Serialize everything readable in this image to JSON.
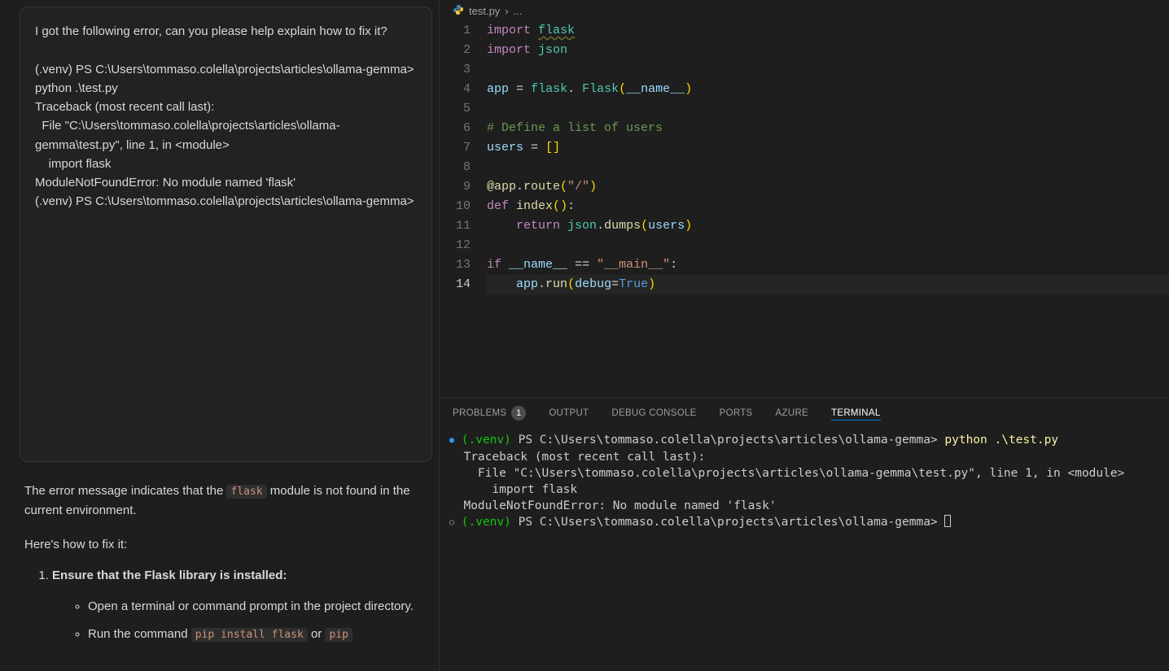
{
  "chat": {
    "user_message": "I got the following error, can you please help explain how to fix it?\n\n(.venv) PS C:\\Users\\tommaso.colella\\projects\\articles\\ollama-gemma> python .\\test.py\nTraceback (most recent call last):\n  File \"C:\\Users\\tommaso.colella\\projects\\articles\\ollama-gemma\\test.py\", line 1, in <module>\n    import flask\nModuleNotFoundError: No module named 'flask'\n(.venv) PS C:\\Users\\tommaso.colella\\projects\\articles\\ollama-gemma>",
    "response_intro_pre": "The error message indicates that the ",
    "response_intro_code": "flask",
    "response_intro_post": " module is not found in the current environment.",
    "response_heres_how": "Here's how to fix it:",
    "step1_title": "Ensure that the Flask library is installed:",
    "step1_a": "Open a terminal or command prompt in the project directory.",
    "step1_b_pre": "Run the command ",
    "step1_b_code1": "pip install flask",
    "step1_b_mid": " or ",
    "step1_b_code2": "pip"
  },
  "breadcrumb": {
    "file": "test.py",
    "sep": "›",
    "more": "..."
  },
  "code_lines": [
    {
      "n": 1,
      "html": "<span class='tok-kw'>import</span> <span class='tok-mod tok-underline'>flask</span>"
    },
    {
      "n": 2,
      "html": "<span class='tok-kw'>import</span> <span class='tok-mod'>json</span>"
    },
    {
      "n": 3,
      "html": ""
    },
    {
      "n": 4,
      "html": "<span class='tok-var'>app</span> <span class='tok-op'>=</span> <span class='tok-mod'>flask</span>. <span class='tok-mod'>Flask</span><span class='tok-paren'>(</span><span class='tok-var'>__name__</span><span class='tok-paren'>)</span>"
    },
    {
      "n": 5,
      "html": ""
    },
    {
      "n": 6,
      "html": "<span class='tok-comment'># Define a list of users</span>"
    },
    {
      "n": 7,
      "html": "<span class='tok-var'>users</span> <span class='tok-op'>=</span> <span class='tok-paren'>[</span><span class='tok-paren'>]</span>"
    },
    {
      "n": 8,
      "html": ""
    },
    {
      "n": 9,
      "html": "<span class='tok-func'>@app.route</span><span class='tok-paren'>(</span><span class='tok-str'>\"/\"</span><span class='tok-paren'>)</span>"
    },
    {
      "n": 10,
      "html": "<span class='tok-kw'>def</span> <span class='tok-func'>index</span><span class='tok-paren'>(</span><span class='tok-paren'>)</span>:"
    },
    {
      "n": 11,
      "html": "    <span class='tok-kw'>return</span> <span class='tok-mod'>json</span>.<span class='tok-func'>dumps</span><span class='tok-paren'>(</span><span class='tok-var'>users</span><span class='tok-paren'>)</span>"
    },
    {
      "n": 12,
      "html": ""
    },
    {
      "n": 13,
      "html": "<span class='tok-kw'>if</span> <span class='tok-var'>__name__</span> <span class='tok-op'>==</span> <span class='tok-str'>\"__main__\"</span>:"
    },
    {
      "n": 14,
      "html": "    <span class='tok-var'>app</span>.<span class='tok-func'>run</span><span class='tok-paren'>(</span><span class='tok-var'>debug</span><span class='tok-op'>=</span><span class='tok-const'>True</span><span class='tok-paren'>)</span>",
      "active": true
    }
  ],
  "panel": {
    "tabs": {
      "problems": "PROBLEMS",
      "problems_badge": "1",
      "output": "OUTPUT",
      "debug": "DEBUG CONSOLE",
      "ports": "PORTS",
      "azure": "AZURE",
      "terminal": "TERMINAL"
    }
  },
  "terminal": {
    "line1_venv": "(.venv)",
    "line1_path": " PS C:\\Users\\tommaso.colella\\projects\\articles\\ollama-gemma> ",
    "line1_cmd": "python .\\test.py",
    "line2": "Traceback (most recent call last):",
    "line3": "  File \"C:\\Users\\tommaso.colella\\projects\\articles\\ollama-gemma\\test.py\", line 1, in <module>",
    "line4": "    import flask",
    "line5": "ModuleNotFoundError: No module named 'flask'",
    "line6_venv": "(.venv)",
    "line6_path": " PS C:\\Users\\tommaso.colella\\projects\\articles\\ollama-gemma> "
  }
}
